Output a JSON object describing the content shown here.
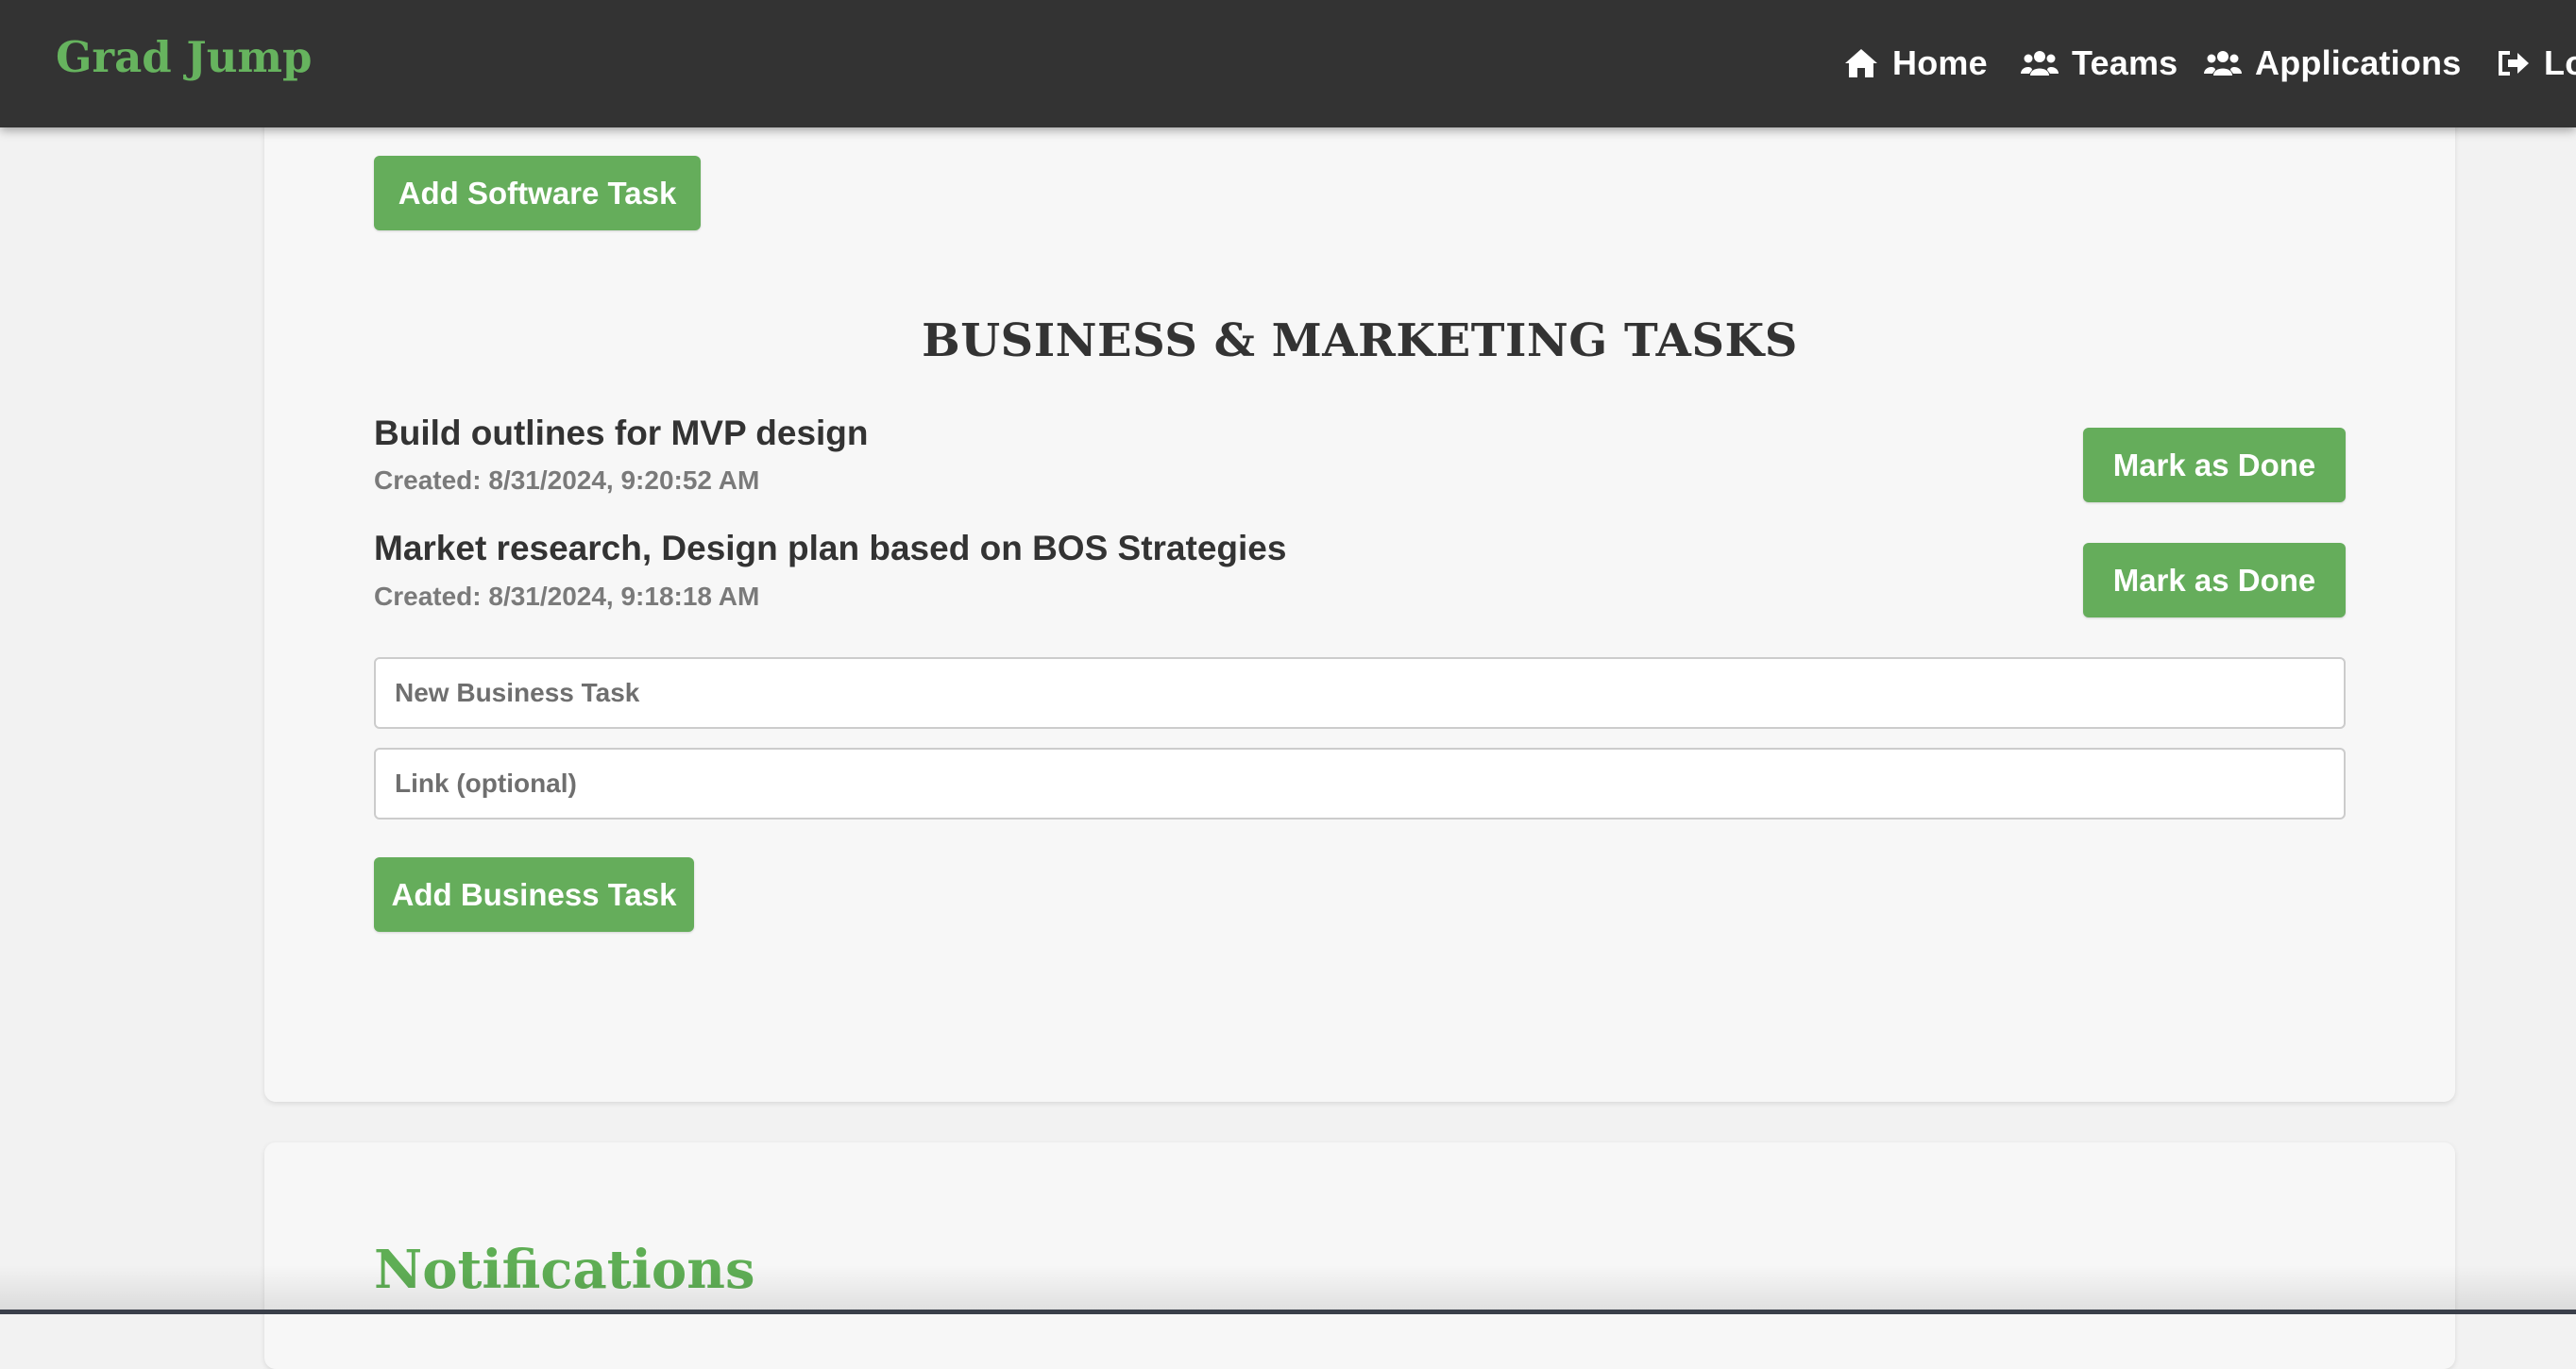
{
  "app": {
    "brand": "Grad Jump"
  },
  "nav": {
    "items": [
      {
        "label": "Home",
        "icon": "home-icon"
      },
      {
        "label": "Teams",
        "icon": "users-icon"
      },
      {
        "label": "Applications",
        "icon": "users-icon"
      },
      {
        "label": "Lo",
        "icon": "sign-out-icon"
      }
    ]
  },
  "software": {
    "add_button": "Add Software Task"
  },
  "business": {
    "heading": "BUSINESS & MARKETING TASKS",
    "tasks": [
      {
        "title": "Build outlines for MVP design",
        "created": "Created: 8/31/2024, 9:20:52 AM",
        "action": "Mark as Done"
      },
      {
        "title": "Market research, Design plan based on BOS Strategies",
        "created": "Created: 8/31/2024, 9:18:18 AM",
        "action": "Mark as Done"
      }
    ],
    "new_task_placeholder": "New Business Task",
    "link_placeholder": "Link (optional)",
    "add_button": "Add Business Task"
  },
  "notifications": {
    "heading": "Notifications"
  },
  "colors": {
    "accent": "#65ad5b",
    "navbar_bg": "#333333",
    "page_bg": "#f2f2f2",
    "card_bg": "#f7f7f7"
  }
}
